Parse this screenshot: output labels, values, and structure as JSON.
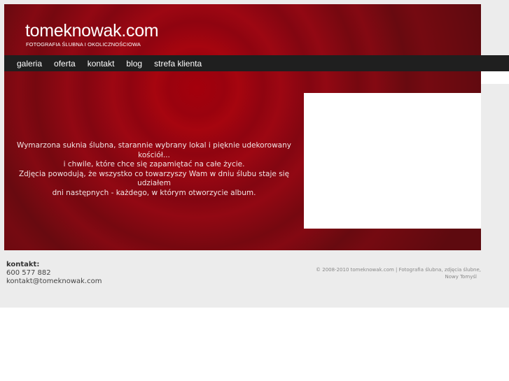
{
  "header": {
    "logo_title": "tomeknowak.com",
    "logo_subtitle": "FOTOGRAFIA ŚLUBNA I OKOLICZNOŚCIOWA"
  },
  "nav": {
    "items": [
      {
        "label": "galeria"
      },
      {
        "label": "oferta"
      },
      {
        "label": "kontakt"
      },
      {
        "label": "blog"
      },
      {
        "label": "strefa klienta"
      }
    ]
  },
  "intro": {
    "line1": "Wymarzona suknia ślubna, starannie wybrany lokal i pięknie udekorowany kościół...",
    "line2": "i chwile, które chce się zapamiętać na całe życie.",
    "line3": "Zdjęcia powodują, że wszystko co towarzyszy Wam w dniu ślubu staje się udziałem",
    "line4": "dni następnych - każdego, w którym otworzycie album."
  },
  "footer": {
    "contact_label": "kontakt:",
    "phone": "600 577 882",
    "email": "kontakt@tomeknowak.com",
    "copyright_line1": "© 2008-2010 tomeknowak.com | Fotografia ślubna, zdjęcia ślubne,",
    "copyright_line2": "Nowy Tomyśl"
  },
  "colors": {
    "banner": "#8a0610",
    "nav_bg": "#1f1f1f",
    "page_bg": "#ececec"
  }
}
